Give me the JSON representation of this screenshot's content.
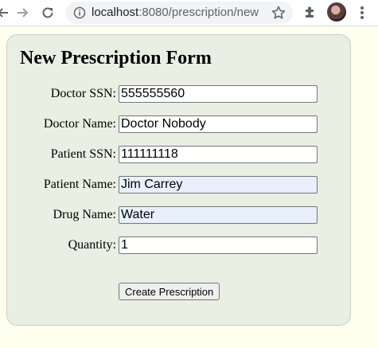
{
  "browser": {
    "url_host": "localhost",
    "url_path": ":8080/prescription/new"
  },
  "form": {
    "title": "New Prescription Form",
    "fields": [
      {
        "label": "Doctor SSN:",
        "value": "555555560"
      },
      {
        "label": "Doctor Name:",
        "value": "Doctor Nobody"
      },
      {
        "label": "Patient SSN:",
        "value": "111111118"
      },
      {
        "label": "Patient Name:",
        "value": "Jim Carrey"
      },
      {
        "label": "Drug Name:",
        "value": "Water"
      },
      {
        "label": "Quantity:",
        "value": "1"
      }
    ],
    "submit_label": "Create Prescription"
  },
  "colors": {
    "page_background": "#fffff0",
    "panel_background": "#e9efe3",
    "autofill_background": "#e8f0fe"
  },
  "icons": [
    "back-arrow-icon",
    "forward-arrow-icon",
    "reload-icon",
    "site-info-icon",
    "star-icon",
    "extensions-icon",
    "avatar",
    "more-menu-icon"
  ]
}
